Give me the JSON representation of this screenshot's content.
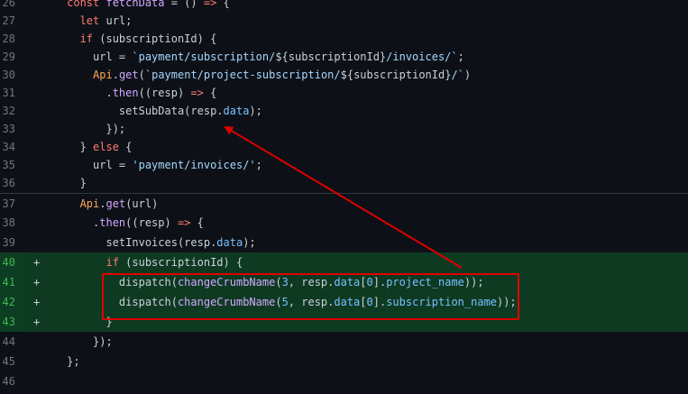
{
  "lines": [
    {
      "num": "26",
      "text": "  const fetchData = () => {"
    },
    {
      "num": "27",
      "text": "    let url;"
    },
    {
      "num": "28",
      "text": "    if (subscriptionId) {"
    },
    {
      "num": "29",
      "text": "      url = `payment/subscription/${subscriptionId}/invoices/`;"
    },
    {
      "num": "30",
      "text": "      Api.get(`payment/project-subscription/${subscriptionId}/`)"
    },
    {
      "num": "31",
      "text": "        .then((resp) => {"
    },
    {
      "num": "32",
      "text": "          setSubData(resp.data);"
    },
    {
      "num": "33",
      "text": "        });"
    },
    {
      "num": "34",
      "text": "    } else {"
    },
    {
      "num": "35",
      "text": "      url = 'payment/invoices/';"
    },
    {
      "num": "36",
      "text": "    }"
    },
    {
      "num": "37",
      "text": "    Api.get(url)"
    },
    {
      "num": "38",
      "text": "      .then((resp) => {"
    },
    {
      "num": "39",
      "text": "        setInvoices(resp.data);"
    },
    {
      "num": "40",
      "text": "        if (subscriptionId) {",
      "added": true
    },
    {
      "num": "41",
      "text": "          dispatch(changeCrumbName(3, resp.data[0].project_name));",
      "added": true
    },
    {
      "num": "42",
      "text": "          dispatch(changeCrumbName(5, resp.data[0].subscription_name));",
      "added": true
    },
    {
      "num": "43",
      "text": "        }",
      "added": true
    },
    {
      "num": "44",
      "text": "      });"
    },
    {
      "num": "45",
      "text": "  };"
    },
    {
      "num": "46",
      "text": ""
    }
  ],
  "added_marker": "+",
  "colors": {
    "annotation": "#e00000",
    "added_bg": "#0f3a22",
    "added_line_number": "#3fb950"
  }
}
